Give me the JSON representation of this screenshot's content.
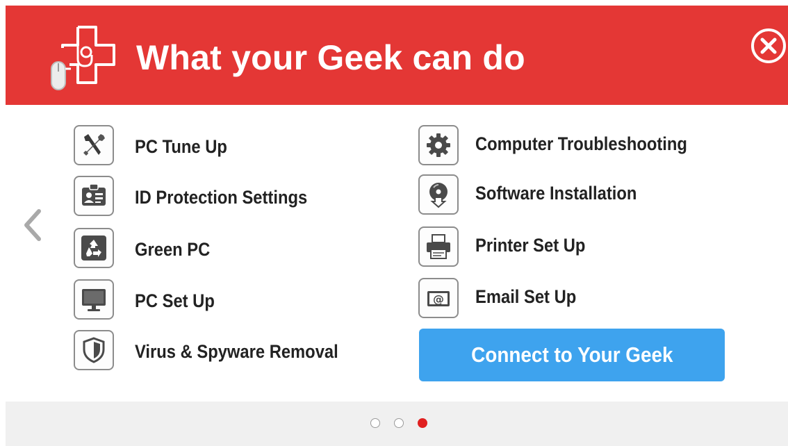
{
  "header": {
    "title": "What your Geek can do",
    "background_color": "#e43735",
    "logo_icon": "cross-mouse-logo-icon",
    "close_icon": "close-circle-icon"
  },
  "navigation": {
    "prev_icon": "chevron-left-icon"
  },
  "services_left": [
    {
      "label": "PC Tune Up",
      "icon": "tools-icon"
    },
    {
      "label": "ID Protection Settings",
      "icon": "id-card-icon"
    },
    {
      "label": "Green PC",
      "icon": "recycle-icon"
    },
    {
      "label": "PC Set Up",
      "icon": "monitor-icon"
    },
    {
      "label": "Virus & Spyware Removal",
      "icon": "shield-icon"
    }
  ],
  "services_right": [
    {
      "label": "Computer Troubleshooting",
      "icon": "gear-icon"
    },
    {
      "label": "Software Installation",
      "icon": "disc-install-icon"
    },
    {
      "label": "Printer Set Up",
      "icon": "printer-icon"
    },
    {
      "label": "Email Set Up",
      "icon": "email-at-icon"
    }
  ],
  "cta": {
    "label": "Connect to Your Geek",
    "color": "#3ea3ee"
  },
  "pagination": {
    "total": 3,
    "active_index": 3,
    "active_color": "#e02020"
  }
}
